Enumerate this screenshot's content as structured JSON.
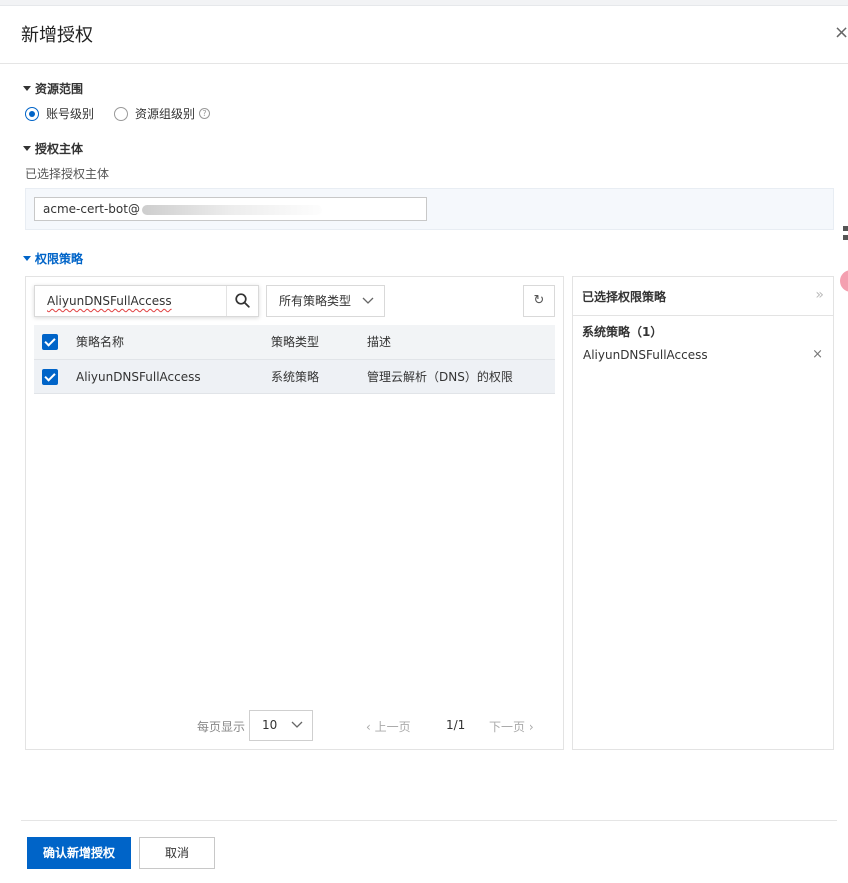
{
  "dialog": {
    "title": "新增授权",
    "close_label": "×"
  },
  "resource_scope": {
    "heading": "资源范围",
    "options": [
      {
        "label": "账号级别",
        "checked": true
      },
      {
        "label": "资源组级别",
        "checked": false
      }
    ],
    "help_icon": "?"
  },
  "principal": {
    "heading": "授权主体",
    "selected_label": "已选择授权主体",
    "value": "acme-cert-bot@"
  },
  "policies": {
    "heading": "权限策略",
    "search_value": "AliyunDNSFullAccess",
    "type_filter": "所有策略类型",
    "refresh_icon": "↻",
    "columns": [
      "策略名称",
      "策略类型",
      "描述"
    ],
    "rows": [
      {
        "name": "AliyunDNSFullAccess",
        "type": "系统策略",
        "description": "管理云解析（DNS）的权限",
        "checked": true
      }
    ],
    "pager": {
      "per_page_label": "每页显示",
      "per_page": "10",
      "prev": "上一页",
      "page": "1/1",
      "next": "下一页"
    }
  },
  "selected_policies": {
    "title": "已选择权限策略",
    "collapse_icon": "»",
    "group_label": "系统策略",
    "group_count": "（1）",
    "items": [
      "AliyunDNSFullAccess"
    ],
    "remove_icon": "×"
  },
  "footer": {
    "confirm_label": "确认新增授权",
    "cancel_label": "取消"
  },
  "colors": {
    "primary": "#0064c8",
    "border": "#e3e3e3"
  }
}
